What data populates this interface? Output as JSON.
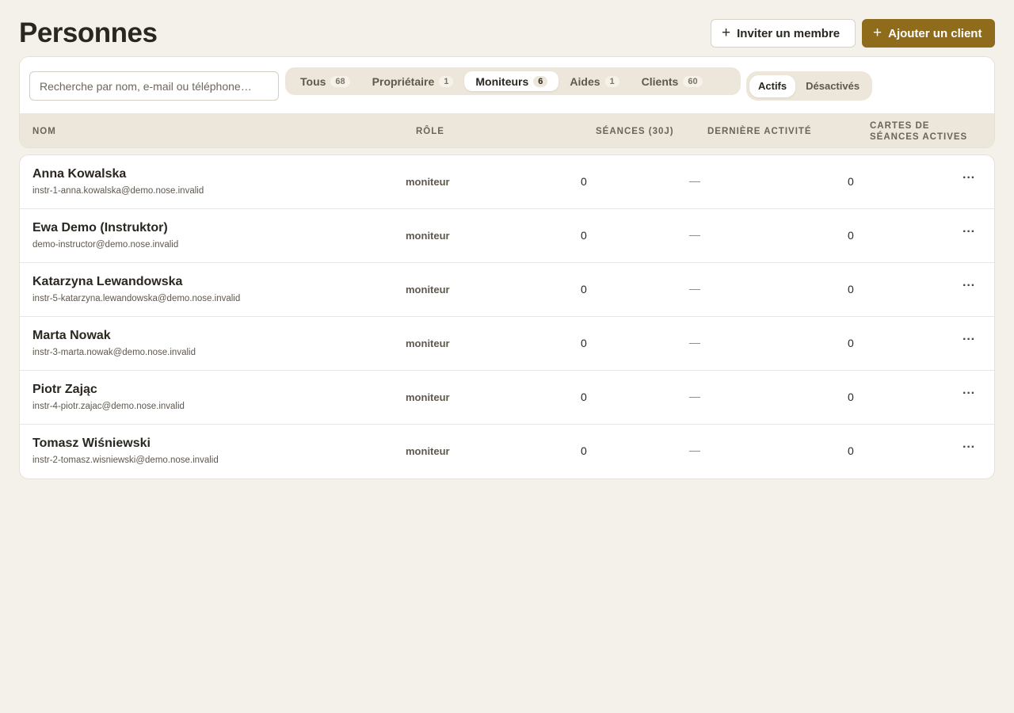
{
  "header": {
    "title": "Personnes",
    "invite_label": "Inviter un membre",
    "add_client_label": "Ajouter un client"
  },
  "filters": {
    "search_placeholder": "Recherche par nom, e-mail ou téléphone…",
    "tabs": [
      {
        "label": "Tous",
        "count": "68",
        "active": false
      },
      {
        "label": "Propriétaire",
        "count": "1",
        "active": false
      },
      {
        "label": "Moniteurs",
        "count": "6",
        "active": true
      },
      {
        "label": "Aides",
        "count": "1",
        "active": false
      },
      {
        "label": "Clients",
        "count": "60",
        "active": false
      }
    ],
    "status": {
      "active_label": "Actifs",
      "disabled_label": "Désactivés",
      "selected": "Actifs"
    }
  },
  "table": {
    "columns": {
      "name": "Nom",
      "role": "Rôle",
      "sessions": "Séances (30j)",
      "last_activity": "Dernière activité",
      "cards": "Cartes de séances actives"
    },
    "rows": [
      {
        "name": "Anna Kowalska",
        "email": "instr-1-anna.kowalska@demo.nose.invalid",
        "role": "moniteur",
        "sessions": "0",
        "last_activity": "—",
        "cards": "0"
      },
      {
        "name": "Ewa Demo (Instruktor)",
        "email": "demo-instructor@demo.nose.invalid",
        "role": "moniteur",
        "sessions": "0",
        "last_activity": "—",
        "cards": "0"
      },
      {
        "name": "Katarzyna Lewandowska",
        "email": "instr-5-katarzyna.lewandowska@demo.nose.invalid",
        "role": "moniteur",
        "sessions": "0",
        "last_activity": "—",
        "cards": "0"
      },
      {
        "name": "Marta Nowak",
        "email": "instr-3-marta.nowak@demo.nose.invalid",
        "role": "moniteur",
        "sessions": "0",
        "last_activity": "—",
        "cards": "0"
      },
      {
        "name": "Piotr Zając",
        "email": "instr-4-piotr.zajac@demo.nose.invalid",
        "role": "moniteur",
        "sessions": "0",
        "last_activity": "—",
        "cards": "0"
      },
      {
        "name": "Tomasz Wiśniewski",
        "email": "instr-2-tomasz.wisniewski@demo.nose.invalid",
        "role": "moniteur",
        "sessions": "0",
        "last_activity": "—",
        "cards": "0"
      }
    ],
    "more_label": "···"
  },
  "colors": {
    "background": "#f4f1eb",
    "primary": "#8f6b1c",
    "table_header": "#ede6da"
  },
  "icons": {
    "invite": "plus-icon",
    "add_client": "plus-icon",
    "row_actions": "more-horizontal-icon"
  }
}
